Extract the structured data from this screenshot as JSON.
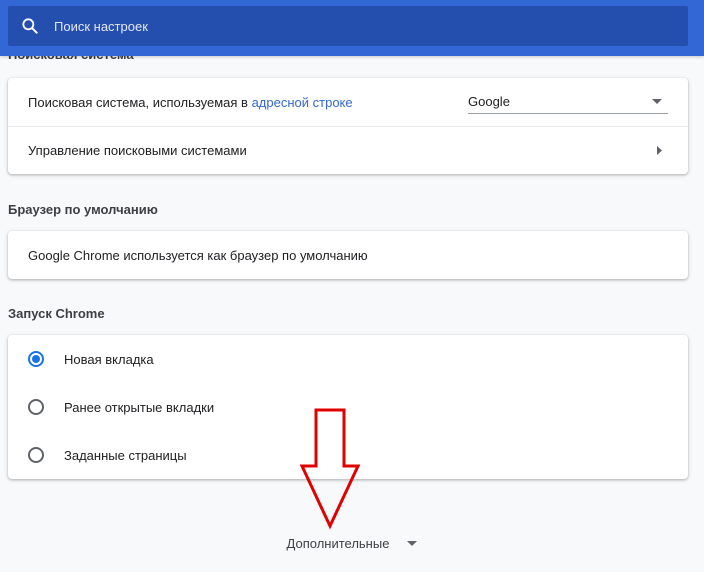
{
  "search": {
    "placeholder": "Поиск настроек"
  },
  "search_engine": {
    "title": "Поисковая система",
    "row1_text": "Поисковая система, используемая в ",
    "row1_link": "адресной строке",
    "select_value": "Google",
    "row2_text": "Управление поисковыми системами"
  },
  "default_browser": {
    "title": "Браузер по умолчанию",
    "text": "Google Chrome используется как браузер по умолчанию"
  },
  "startup": {
    "title": "Запуск Chrome",
    "options": [
      {
        "label": "Новая вкладка",
        "checked": true
      },
      {
        "label": "Ранее открытые вкладки",
        "checked": false
      },
      {
        "label": "Заданные страницы",
        "checked": false
      }
    ]
  },
  "advanced": {
    "label": "Дополнительные"
  },
  "colors": {
    "header": "#3367d6",
    "search_bg": "#254fae",
    "accent": "#1a73e8",
    "annotation_arrow": "#e00000"
  },
  "icons": {
    "search": "search-icon",
    "dropdown": "triangle-down-icon",
    "chevron": "chevron-right-icon",
    "annotation": "down-arrow-annotation"
  }
}
